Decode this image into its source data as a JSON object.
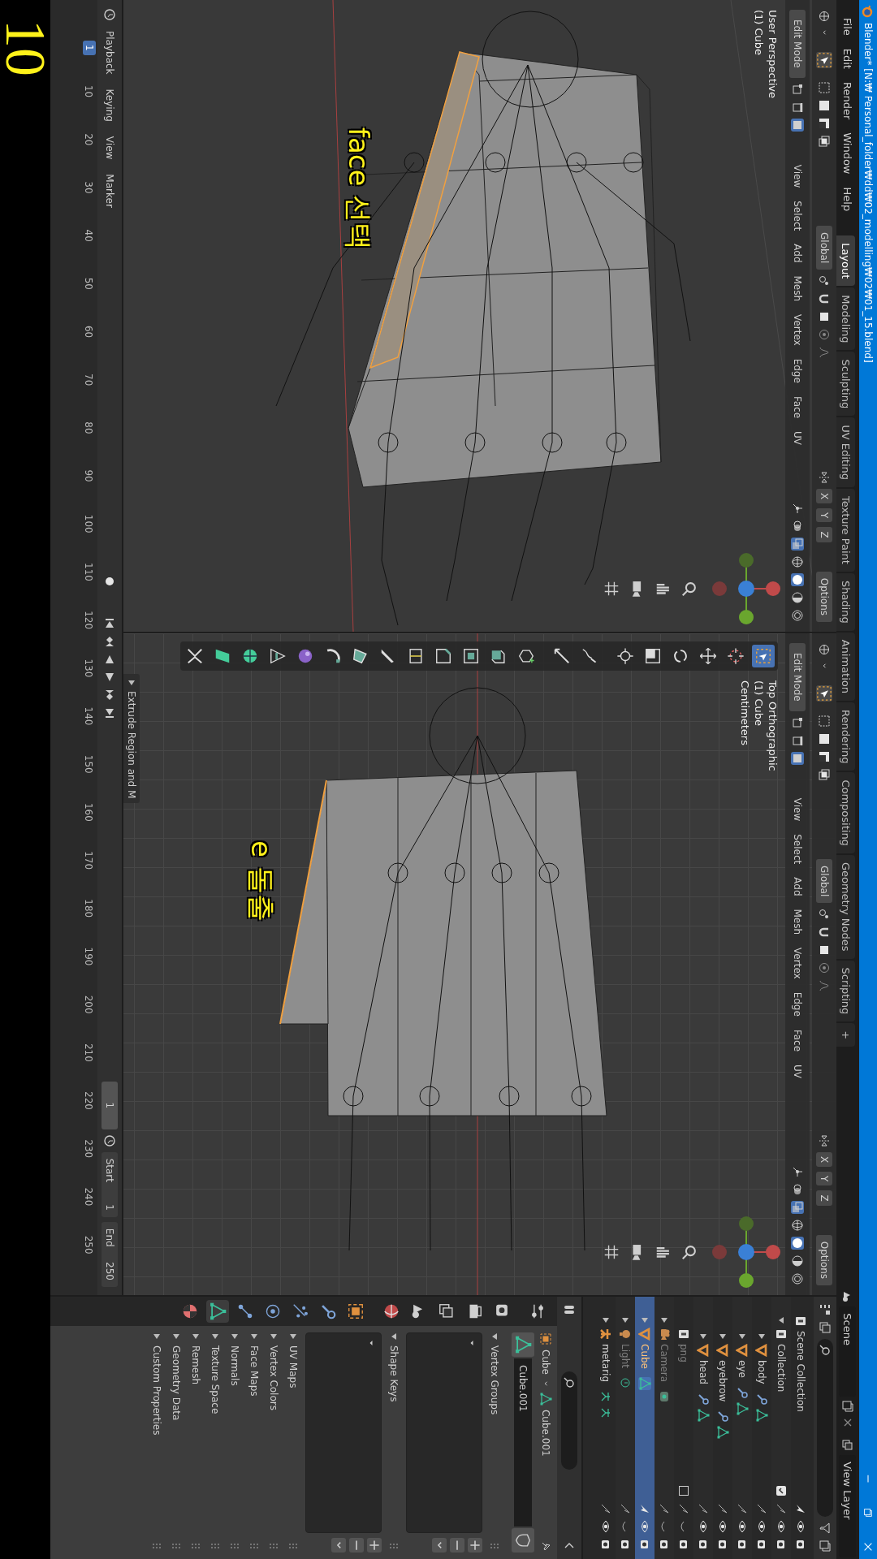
{
  "title_bar": {
    "title": "Blender* [N:₩ Personal_folder₩dd₩02_modelling₩02₩01_15.blend]"
  },
  "menu": [
    "File",
    "Edit",
    "Render",
    "Window",
    "Help"
  ],
  "workspace_tabs": [
    {
      "label": "Layout",
      "selected": true
    },
    {
      "label": "Modeling",
      "selected": false
    },
    {
      "label": "Sculpting",
      "selected": false
    },
    {
      "label": "UV Editing",
      "selected": false
    },
    {
      "label": "Texture Paint",
      "selected": false
    },
    {
      "label": "Shading",
      "selected": false
    },
    {
      "label": "Animation",
      "selected": false
    },
    {
      "label": "Rendering",
      "selected": false
    },
    {
      "label": "Compositing",
      "selected": false
    },
    {
      "label": "Geometry Nodes",
      "selected": false
    },
    {
      "label": "Scripting",
      "selected": false
    },
    {
      "label": "+",
      "selected": false
    }
  ],
  "scene": {
    "label": "Scene"
  },
  "view_layer": {
    "label": "View Layer"
  },
  "viewports": [
    {
      "kind": "perspective",
      "mode": "Edit Mode",
      "menus": [
        "View",
        "Select",
        "Add",
        "Mesh",
        "Vertex",
        "Edge",
        "Face",
        "UV"
      ],
      "orientation": "Global",
      "axes": [
        "X",
        "Y",
        "Z"
      ],
      "options": "Options",
      "overlay_lines": [
        "User Perspective",
        "(1) Cube"
      ],
      "annotation": "face 선택"
    },
    {
      "kind": "top",
      "mode": "Edit Mode",
      "menus": [
        "View",
        "Select",
        "Add",
        "Mesh",
        "Vertex",
        "Edge",
        "Face",
        "UV"
      ],
      "orientation": "Global",
      "axes": [
        "X",
        "Y",
        "Z"
      ],
      "options": "Options",
      "overlay_lines": [
        "Top Orthographic",
        "(1) Cube",
        "Centimeters"
      ],
      "annotation": "e 돌출",
      "last_operator": "Extrude Region and M",
      "toolbar": [
        {
          "kind": "select",
          "selected": true
        },
        {
          "kind": "cursor",
          "selected": false
        },
        {
          "kind": "move",
          "selected": false
        },
        {
          "kind": "rotate",
          "selected": false
        },
        {
          "kind": "scale",
          "selected": false
        },
        {
          "kind": "transform",
          "selected": false
        },
        {
          "kind": "annotate",
          "selected": false
        },
        {
          "kind": "measure",
          "selected": false
        },
        {
          "kind": "add",
          "selected": false
        },
        {
          "kind": "extrude",
          "selected": false
        },
        {
          "kind": "inset",
          "selected": false
        },
        {
          "kind": "bevel",
          "selected": false
        },
        {
          "kind": "loopcut",
          "selected": false
        },
        {
          "kind": "knife",
          "selected": false
        },
        {
          "kind": "polybuild",
          "selected": false
        },
        {
          "kind": "spin",
          "selected": false
        },
        {
          "kind": "smooth",
          "selected": false
        },
        {
          "kind": "slide",
          "selected": false
        },
        {
          "kind": "shrink",
          "selected": false
        },
        {
          "kind": "shear",
          "selected": false
        },
        {
          "kind": "rip",
          "selected": false
        }
      ]
    }
  ],
  "timeline": {
    "menus": [
      "Playback",
      "Keying",
      "View",
      "Marker"
    ],
    "current_frame": "1",
    "start_label": "Start",
    "start": "1",
    "end_label": "End",
    "end": "250",
    "ruler": [
      "10",
      "20",
      "30",
      "40",
      "50",
      "60",
      "70",
      "80",
      "90",
      "100",
      "110",
      "120",
      "130",
      "140",
      "150",
      "160",
      "170",
      "180",
      "190",
      "200",
      "210",
      "220",
      "230",
      "240",
      "250"
    ],
    "marker": "1"
  },
  "outliner": {
    "root": {
      "name": "Scene Collection",
      "children": [
        {
          "name": "Collection",
          "kind": "collection",
          "checked": true,
          "expanded": true,
          "selected": false,
          "hidden": false,
          "modifiers": false,
          "children": [
            {
              "name": "body",
              "kind": "mesh",
              "expanded": false,
              "selected": false,
              "hidden": false,
              "modifiers": true
            },
            {
              "name": "eye",
              "kind": "mesh",
              "expanded": false,
              "selected": false,
              "hidden": false,
              "modifiers": true
            },
            {
              "name": "eyebrow",
              "kind": "mesh",
              "expanded": false,
              "selected": false,
              "hidden": false,
              "modifiers": true
            },
            {
              "name": "head",
              "kind": "mesh",
              "expanded": false,
              "selected": false,
              "hidden": false,
              "modifiers": true
            }
          ]
        },
        {
          "name": "png",
          "kind": "collection",
          "checked": false,
          "selected": false,
          "hidden": true,
          "modifiers": false
        },
        {
          "name": "Camera",
          "kind": "camera",
          "expanded": false,
          "selected": false,
          "hidden": true,
          "modifiers": false
        },
        {
          "name": "Cube",
          "kind": "mesh",
          "expanded": false,
          "selected": true,
          "hidden": false,
          "modifiers": false
        },
        {
          "name": "Light",
          "kind": "light",
          "expanded": false,
          "selected": false,
          "hidden": true,
          "modifiers": false
        },
        {
          "name": "metarig",
          "kind": "armature",
          "expanded": false,
          "selected": false,
          "hidden": false,
          "modifiers": false
        }
      ]
    }
  },
  "properties": {
    "tabs": [
      {
        "kind": "tool",
        "selected": false
      },
      {
        "kind": "render",
        "selected": false
      },
      {
        "kind": "output",
        "selected": false
      },
      {
        "kind": "viewlayer",
        "selected": false
      },
      {
        "kind": "scene",
        "selected": false
      },
      {
        "kind": "world",
        "selected": false
      },
      {
        "kind": "object",
        "selected": false
      },
      {
        "kind": "modifiers",
        "selected": false
      },
      {
        "kind": "particles",
        "selected": false
      },
      {
        "kind": "physics",
        "selected": false
      },
      {
        "kind": "constraints",
        "selected": false
      },
      {
        "kind": "data",
        "selected": true
      },
      {
        "kind": "material",
        "selected": false
      }
    ],
    "breadcrumb": [
      "Cube",
      "Cube.001"
    ],
    "mesh_name": "Cube.001",
    "panels": [
      {
        "title": "Vertex Groups",
        "expanded": true
      },
      {
        "title": "Shape Keys",
        "expanded": true
      },
      {
        "title": "UV Maps",
        "expanded": false
      },
      {
        "title": "Vertex Colors",
        "expanded": false
      },
      {
        "title": "Face Maps",
        "expanded": false
      },
      {
        "title": "Normals",
        "expanded": false
      },
      {
        "title": "Texture Space",
        "expanded": false
      },
      {
        "title": "Remesh",
        "expanded": false
      },
      {
        "title": "Geometry Data",
        "expanded": false
      },
      {
        "title": "Custom Properties",
        "expanded": false
      }
    ]
  },
  "slide_number": "10"
}
